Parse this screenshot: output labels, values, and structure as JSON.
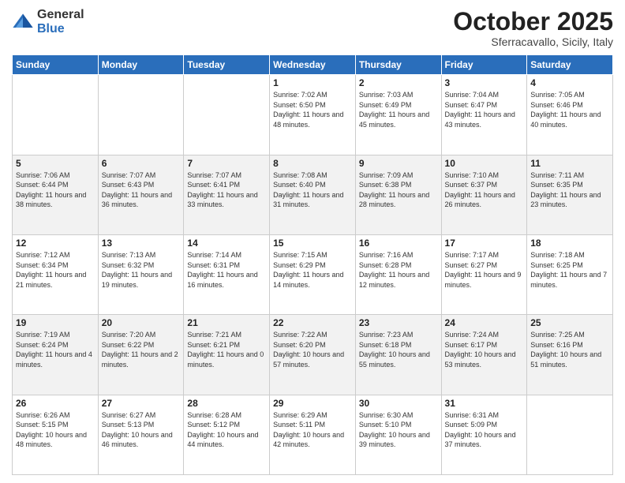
{
  "logo": {
    "general": "General",
    "blue": "Blue"
  },
  "header": {
    "title": "October 2025",
    "subtitle": "Sferracavallo, Sicily, Italy"
  },
  "weekdays": [
    "Sunday",
    "Monday",
    "Tuesday",
    "Wednesday",
    "Thursday",
    "Friday",
    "Saturday"
  ],
  "weeks": [
    [
      {
        "day": "",
        "info": ""
      },
      {
        "day": "",
        "info": ""
      },
      {
        "day": "",
        "info": ""
      },
      {
        "day": "1",
        "info": "Sunrise: 7:02 AM\nSunset: 6:50 PM\nDaylight: 11 hours and 48 minutes."
      },
      {
        "day": "2",
        "info": "Sunrise: 7:03 AM\nSunset: 6:49 PM\nDaylight: 11 hours and 45 minutes."
      },
      {
        "day": "3",
        "info": "Sunrise: 7:04 AM\nSunset: 6:47 PM\nDaylight: 11 hours and 43 minutes."
      },
      {
        "day": "4",
        "info": "Sunrise: 7:05 AM\nSunset: 6:46 PM\nDaylight: 11 hours and 40 minutes."
      }
    ],
    [
      {
        "day": "5",
        "info": "Sunrise: 7:06 AM\nSunset: 6:44 PM\nDaylight: 11 hours and 38 minutes."
      },
      {
        "day": "6",
        "info": "Sunrise: 7:07 AM\nSunset: 6:43 PM\nDaylight: 11 hours and 36 minutes."
      },
      {
        "day": "7",
        "info": "Sunrise: 7:07 AM\nSunset: 6:41 PM\nDaylight: 11 hours and 33 minutes."
      },
      {
        "day": "8",
        "info": "Sunrise: 7:08 AM\nSunset: 6:40 PM\nDaylight: 11 hours and 31 minutes."
      },
      {
        "day": "9",
        "info": "Sunrise: 7:09 AM\nSunset: 6:38 PM\nDaylight: 11 hours and 28 minutes."
      },
      {
        "day": "10",
        "info": "Sunrise: 7:10 AM\nSunset: 6:37 PM\nDaylight: 11 hours and 26 minutes."
      },
      {
        "day": "11",
        "info": "Sunrise: 7:11 AM\nSunset: 6:35 PM\nDaylight: 11 hours and 23 minutes."
      }
    ],
    [
      {
        "day": "12",
        "info": "Sunrise: 7:12 AM\nSunset: 6:34 PM\nDaylight: 11 hours and 21 minutes."
      },
      {
        "day": "13",
        "info": "Sunrise: 7:13 AM\nSunset: 6:32 PM\nDaylight: 11 hours and 19 minutes."
      },
      {
        "day": "14",
        "info": "Sunrise: 7:14 AM\nSunset: 6:31 PM\nDaylight: 11 hours and 16 minutes."
      },
      {
        "day": "15",
        "info": "Sunrise: 7:15 AM\nSunset: 6:29 PM\nDaylight: 11 hours and 14 minutes."
      },
      {
        "day": "16",
        "info": "Sunrise: 7:16 AM\nSunset: 6:28 PM\nDaylight: 11 hours and 12 minutes."
      },
      {
        "day": "17",
        "info": "Sunrise: 7:17 AM\nSunset: 6:27 PM\nDaylight: 11 hours and 9 minutes."
      },
      {
        "day": "18",
        "info": "Sunrise: 7:18 AM\nSunset: 6:25 PM\nDaylight: 11 hours and 7 minutes."
      }
    ],
    [
      {
        "day": "19",
        "info": "Sunrise: 7:19 AM\nSunset: 6:24 PM\nDaylight: 11 hours and 4 minutes."
      },
      {
        "day": "20",
        "info": "Sunrise: 7:20 AM\nSunset: 6:22 PM\nDaylight: 11 hours and 2 minutes."
      },
      {
        "day": "21",
        "info": "Sunrise: 7:21 AM\nSunset: 6:21 PM\nDaylight: 11 hours and 0 minutes."
      },
      {
        "day": "22",
        "info": "Sunrise: 7:22 AM\nSunset: 6:20 PM\nDaylight: 10 hours and 57 minutes."
      },
      {
        "day": "23",
        "info": "Sunrise: 7:23 AM\nSunset: 6:18 PM\nDaylight: 10 hours and 55 minutes."
      },
      {
        "day": "24",
        "info": "Sunrise: 7:24 AM\nSunset: 6:17 PM\nDaylight: 10 hours and 53 minutes."
      },
      {
        "day": "25",
        "info": "Sunrise: 7:25 AM\nSunset: 6:16 PM\nDaylight: 10 hours and 51 minutes."
      }
    ],
    [
      {
        "day": "26",
        "info": "Sunrise: 6:26 AM\nSunset: 5:15 PM\nDaylight: 10 hours and 48 minutes."
      },
      {
        "day": "27",
        "info": "Sunrise: 6:27 AM\nSunset: 5:13 PM\nDaylight: 10 hours and 46 minutes."
      },
      {
        "day": "28",
        "info": "Sunrise: 6:28 AM\nSunset: 5:12 PM\nDaylight: 10 hours and 44 minutes."
      },
      {
        "day": "29",
        "info": "Sunrise: 6:29 AM\nSunset: 5:11 PM\nDaylight: 10 hours and 42 minutes."
      },
      {
        "day": "30",
        "info": "Sunrise: 6:30 AM\nSunset: 5:10 PM\nDaylight: 10 hours and 39 minutes."
      },
      {
        "day": "31",
        "info": "Sunrise: 6:31 AM\nSunset: 5:09 PM\nDaylight: 10 hours and 37 minutes."
      },
      {
        "day": "",
        "info": ""
      }
    ]
  ]
}
